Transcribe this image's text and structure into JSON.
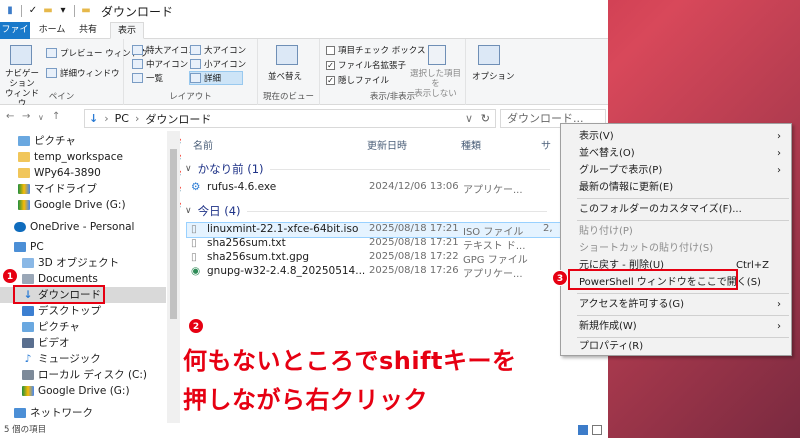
{
  "window": {
    "title": "ダウンロード"
  },
  "ribbon": {
    "tabs": [
      "ファイル",
      "ホーム",
      "共有",
      "表示"
    ],
    "pane": {
      "nav_pane": "ナビゲーション\nウィンドウ",
      "preview": "プレビュー ウィンドウ",
      "details": "詳細ウィンドウ",
      "label": "ペイン"
    },
    "layout": {
      "items": [
        "特大アイコン",
        "大アイコン",
        "中アイコン",
        "小アイコン",
        "一覧",
        "詳細"
      ],
      "label": "レイアウト"
    },
    "current_view": {
      "sort": "並べ替え",
      "label": "現在のビュー"
    },
    "show_hide": {
      "item_checkboxes": "項目チェック ボックス",
      "file_extensions": "ファイル名拡張子",
      "hidden_items": "隠しファイル",
      "hide_selected": "選択した項目を\n表示しない",
      "label": "表示/非表示"
    },
    "options": "オプション"
  },
  "address": {
    "path": [
      "PC",
      "ダウンロード"
    ],
    "search_placeholder": "ダウンロード..."
  },
  "sidebar": {
    "quick": [
      {
        "label": "ピクチャ",
        "pinned": true
      },
      {
        "label": "temp_workspace",
        "pinned": true
      },
      {
        "label": "WPy64-3890",
        "pinned": true
      },
      {
        "label": "マイドライブ",
        "pinned": true
      },
      {
        "label": "Google Drive (G:)",
        "pinned": true
      }
    ],
    "onedrive": "OneDrive - Personal",
    "pc": "PC",
    "pc_items": [
      "3D オブジェクト",
      "Documents",
      "ダウンロード",
      "デスクトップ",
      "ピクチャ",
      "ビデオ",
      "ミュージック",
      "ローカル ディスク (C:)",
      "Google Drive (G:)"
    ],
    "network": "ネットワーク"
  },
  "columns": {
    "name": "名前",
    "date": "更新日時",
    "type": "種類",
    "size": "サ"
  },
  "groups": [
    {
      "header": "かなり前 (1)",
      "files": [
        {
          "name": "rufus-4.6.exe",
          "date": "2024/12/06 13:06",
          "type": "アプリケー..."
        }
      ]
    },
    {
      "header": "今日 (4)",
      "files": [
        {
          "name": "linuxmint-22.1-xfce-64bit.iso",
          "date": "2025/08/18 17:21",
          "type": "ISO ファイル",
          "size": "2,"
        },
        {
          "name": "sha256sum.txt",
          "date": "2025/08/18 17:21",
          "type": "テキスト ド..."
        },
        {
          "name": "sha256sum.txt.gpg",
          "date": "2025/08/18 17:22",
          "type": "GPG ファイル"
        },
        {
          "name": "gnupg-w32-2.4.8_20250514...",
          "date": "2025/08/18 17:26",
          "type": "アプリケー..."
        }
      ]
    }
  ],
  "status": "5 個の項目",
  "context_menu": {
    "items": [
      {
        "label": "表示(V)",
        "submenu": true
      },
      {
        "label": "並べ替え(O)",
        "submenu": true
      },
      {
        "label": "グループで表示(P)",
        "submenu": true
      },
      {
        "label": "最新の情報に更新(E)"
      },
      {
        "label": "このフォルダーのカスタマイズ(F)..."
      },
      {
        "label": "貼り付け(P)",
        "disabled": true
      },
      {
        "label": "ショートカットの貼り付け(S)",
        "disabled": true
      },
      {
        "label": "元に戻す - 削除(U)",
        "shortcut": "Ctrl+Z"
      },
      {
        "label": "PowerShell ウィンドウをここで開く(S)"
      },
      {
        "label": "アクセスを許可する(G)",
        "submenu": true
      },
      {
        "label": "新規作成(W)",
        "submenu": true
      },
      {
        "label": "プロパティ(R)"
      }
    ],
    "arrow": "›"
  },
  "annotations": {
    "badges": [
      "1",
      "2",
      "3"
    ],
    "instruction_line1": "何もないところでshiftキーを",
    "instruction_line2": "押しながら右クリック"
  }
}
